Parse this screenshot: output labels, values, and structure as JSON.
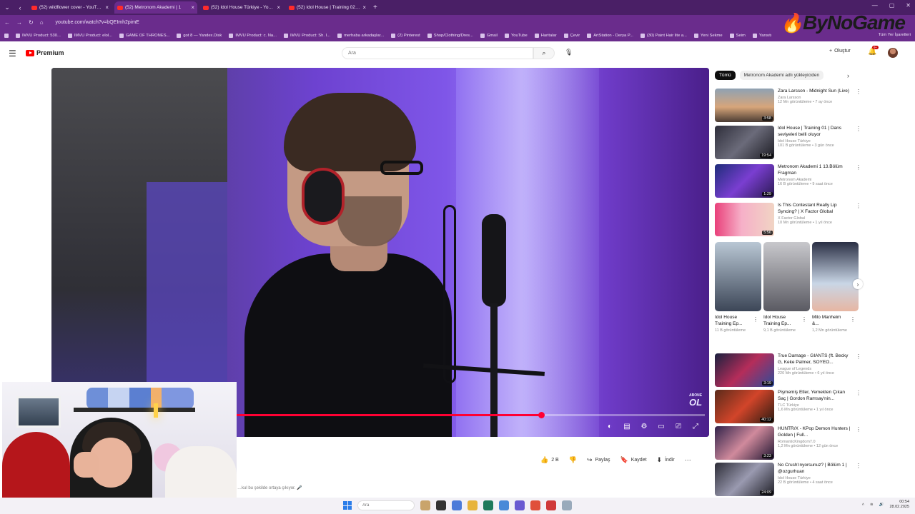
{
  "browser": {
    "tabs": [
      {
        "title": "(52) wildflower cover - YouTube",
        "active": false
      },
      {
        "title": "(52) Metronom Akademi | 1",
        "active": true
      },
      {
        "title": "(52) Idol House Türkiye - YouTube",
        "active": false
      },
      {
        "title": "(52) Idol House | Training 02 | Y",
        "active": false
      }
    ],
    "url": "youtube.com/watch?v=bQEImh2pimE",
    "bookmarks": [
      "IMVU Product: 530...",
      "IMVU Product: elol...",
      "GAME OF THRONES...",
      "got 8 — Yandex.Disk",
      "IMVU Product: c. Na...",
      "IMVU Product: Sh. I...",
      "merhaba arkadaşlar...",
      "(2) Pinterest",
      "Shop/Clothing/Dres...",
      "Gmail",
      "YouTube",
      "Haritalar",
      "Çevir",
      "ArtStation - Derya P...",
      "(30) Paint Hair lite a...",
      "Yeni Sekme",
      "Seim",
      "Yansıtı"
    ],
    "bookmarks_right": "Tüm Yer İşaretleri"
  },
  "overlay_logo": "ByNoGame",
  "youtube": {
    "brand": "Premium",
    "search_placeholder": "Ara",
    "create_label": "Oluştur",
    "notifications_badge": "9+"
  },
  "video": {
    "progress_fraction": 0.75,
    "watermark_top": "ABONE",
    "watermark_big": "OL"
  },
  "actions": {
    "likes": "2 B",
    "share": "Paylaş",
    "save": "Kaydet",
    "download": "İndir"
  },
  "description_snippet": "…kul bu şekilde ortaya çıkıyor. 🎤",
  "sidebar": {
    "chips": [
      "Tümü",
      "Metronom Akademi adlı yükleyiciden"
    ],
    "recommendations_top": [
      {
        "title": "Zara Larsson - Midnight Sun (Live)",
        "channel": "Zara Larsson",
        "views": "12 Mn görüntüleme • 7 ay önce",
        "duration": "3:58"
      },
      {
        "title": "Idol House | Training 01 | Dans seviyeleri belli oluyor",
        "channel": "Idol House Türkiye",
        "views": "101 B görüntüleme • 3 gün önce",
        "duration": "19:54"
      },
      {
        "title": "Metronom Akademi 1 13.Bölüm Fragman",
        "channel": "Metronom Akademi",
        "views": "16 B görüntüleme • 9 saat önce",
        "duration": "1:29"
      },
      {
        "title": "Is This Contestant Really Lip Syncing? | X Factor Global",
        "channel": "X Factor Global",
        "views": "10 Mn görüntüleme • 1 yıl önce",
        "duration": "5:56"
      }
    ],
    "shorts": [
      {
        "title": "Idol House Training Ep...",
        "views": "11 B görüntüleme"
      },
      {
        "title": "Idol House Training Ep...",
        "views": "9,1 B görüntüleme"
      },
      {
        "title": "Milo Manheim &...",
        "views": "1,2 Mn görüntüleme"
      }
    ],
    "recommendations_bottom": [
      {
        "title": "True Damage - GIANTS (ft. Becky G, Keke Palmer, SOYEO...",
        "channel": "League of Legends",
        "views": "220 Mn görüntüleme • 6 yıl önce",
        "duration": "3:19"
      },
      {
        "title": "Pişmemiş Etler, Yemekten Çıkan Saç | Gordon Ramsay'nin...",
        "channel": "TLC Türkiye",
        "views": "1,6 Mn görüntüleme • 1 yıl önce",
        "duration": "40:12"
      },
      {
        "title": "HUNTR/X - KPop Demon Hunters | Golden | Full...",
        "channel": "RomanticKingdom7.0",
        "views": "1,2 Mn görüntüleme • 12 gün önce",
        "duration": "3:23"
      },
      {
        "title": "No Crush'ınyorsunuz? | Bölüm 1 | @ozgurhuan",
        "channel": "Idol House Türkiye",
        "views": "22 B görüntüleme • 4 saat önce",
        "duration": "24:09"
      }
    ]
  },
  "taskbar": {
    "search_placeholder": "Ara",
    "time": "00:54",
    "date": "28.02.2025"
  }
}
